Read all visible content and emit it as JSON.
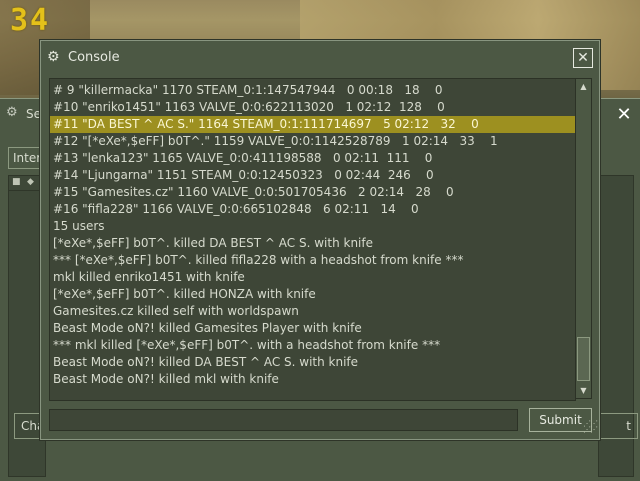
{
  "hud": {
    "number": "34"
  },
  "background_dialog": {
    "title": "Se",
    "tab_label": "Inter",
    "chat_button": "Cha",
    "right_button": "t",
    "close_glyph": "✕"
  },
  "console": {
    "title": "Console",
    "close_glyph": "✕",
    "submit_label": "Submit",
    "input_value": "",
    "selected_line": 2,
    "lines": [
      "# 9 \"killermacka\" 1170 STEAM_0:1:147547944   0 00:18   18    0",
      "#10 \"enriko1451\" 1163 VALVE_0:0:622113020   1 02:12  128    0",
      "#11 \"DA BEST ^ AC S.\" 1164 STEAM_0:1:111714697   5 02:12   32    0",
      "#12 \"[*eXe*,$eFF] b0T^.\" 1159 VALVE_0:0:1142528789   1 02:14   33    1",
      "#13 \"lenka123\" 1165 VALVE_0:0:411198588   0 02:11  111    0",
      "#14 \"Ljungarna\" 1151 STEAM_0:0:12450323   0 02:44  246    0",
      "#15 \"Gamesites.cz\" 1160 VALVE_0:0:501705436   2 02:14   28    0",
      "#16 \"fifla228\" 1166 VALVE_0:0:665102848   6 02:11   14    0",
      "15 users",
      "[*eXe*,$eFF] b0T^. killed DA BEST ^ AC S. with knife",
      "*** [*eXe*,$eFF] b0T^. killed fifla228 with a headshot from knife ***",
      "mkl killed enriko1451 with knife",
      "[*eXe*,$eFF] b0T^. killed HONZA with knife",
      "Gamesites.cz killed self with worldspawn",
      "Beast Mode oN?! killed Gamesites Player with knife",
      "*** mkl killed [*eXe*,$eFF] b0T^. with a headshot from knife ***",
      "Beast Mode oN?! killed DA BEST ^ AC S. with knife",
      "Beast Mode oN?! killed mkl with knife"
    ]
  }
}
